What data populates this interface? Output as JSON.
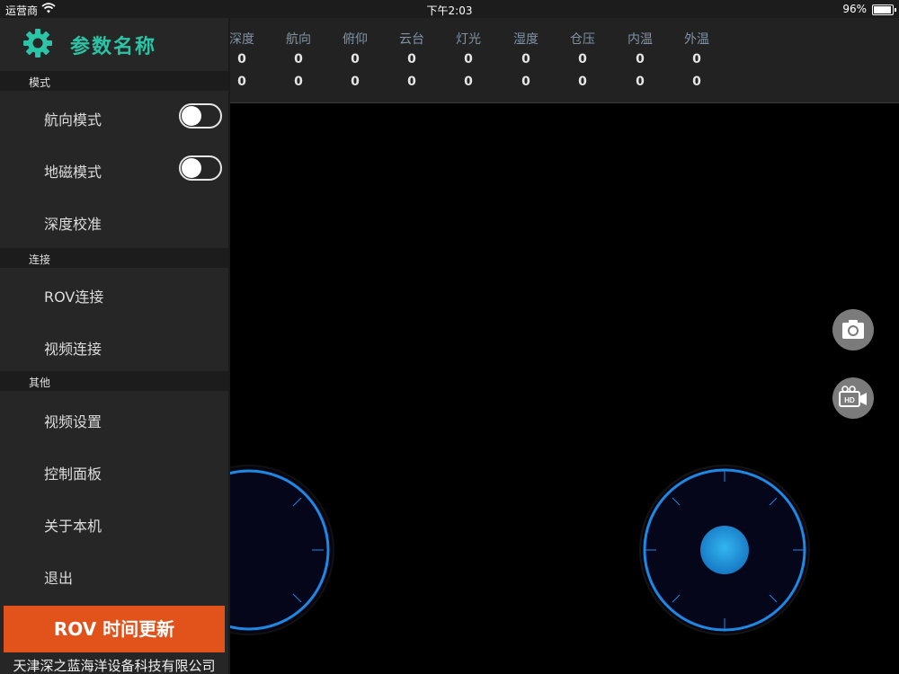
{
  "status": {
    "carrier": "运营商",
    "time": "下午2:03",
    "battery": "96%",
    "battery_level": 0.96
  },
  "sidebar": {
    "title": "参数名称",
    "sections": [
      {
        "header": "模式",
        "items": [
          {
            "label": "航向模式",
            "toggle": false
          },
          {
            "label": "地磁模式",
            "toggle": false
          },
          {
            "label": "深度校准"
          }
        ]
      },
      {
        "header": "连接",
        "items": [
          {
            "label": "ROV连接"
          },
          {
            "label": "视频连接"
          }
        ]
      },
      {
        "header": "其他",
        "items": [
          {
            "label": "视频设置"
          },
          {
            "label": "控制面板"
          },
          {
            "label": "关于本机"
          },
          {
            "label": "退出"
          }
        ]
      }
    ],
    "sync_button": "ROV 时间更新",
    "footer": "天津深之蓝海洋设备科技有限公司"
  },
  "telemetry": {
    "headers": [
      "深度",
      "航向",
      "俯仰",
      "云台",
      "灯光",
      "湿度",
      "仓压",
      "内温",
      "外温"
    ],
    "row1": [
      "0",
      "0",
      "0",
      "0",
      "0",
      "0",
      "0",
      "0",
      "0"
    ],
    "row2": [
      "0",
      "0",
      "0",
      "0",
      "0",
      "0",
      "0",
      "0",
      "0"
    ]
  },
  "controls": {
    "camera_icon": "camera-icon",
    "video_icon": "hd-video-icon"
  },
  "colors": {
    "accent": "#2cc4a6",
    "sync_button": "#e2531c",
    "joystick_ring": "#1e88e5",
    "joystick_knob": "#1f9be0"
  }
}
